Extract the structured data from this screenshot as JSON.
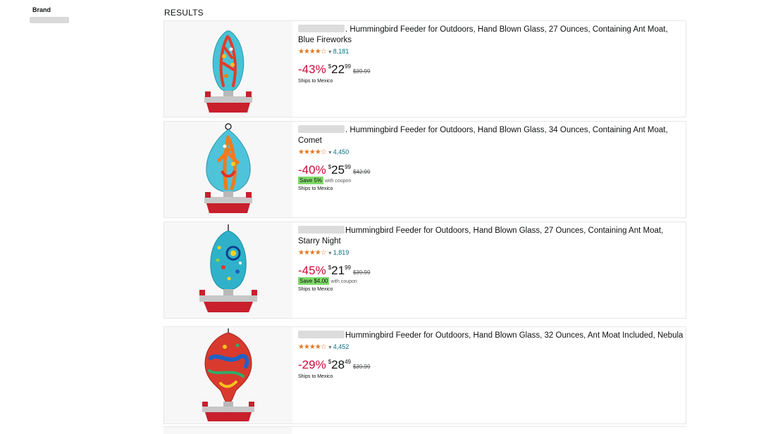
{
  "sidebar": {
    "brand_heading": "Brand"
  },
  "results": {
    "heading": "RESULTS",
    "items": [
      {
        "title": ". Hummingbird Feeder for Outdoors, Hand Blown Glass, 27 Ounces, Containing Ant Moat, Blue Fireworks",
        "stars": "★★★★☆",
        "rating_count": "8,181",
        "discount": "-43%",
        "currency": "$",
        "price_whole": "22",
        "price_fraction": "99",
        "list_price": "$39.99",
        "coupon_badge": "",
        "coupon_text": "",
        "shipping": "Ships to Mexico"
      },
      {
        "title": ". Hummingbird Feeder for Outdoors, Hand Blown Glass, 34 Ounces, Containing Ant Moat, Comet",
        "stars": "★★★★☆",
        "rating_count": "4,450",
        "discount": "-40%",
        "currency": "$",
        "price_whole": "25",
        "price_fraction": "99",
        "list_price": "$42.99",
        "coupon_badge": "Save 5%",
        "coupon_text": "with coupon",
        "shipping": "Ships to Mexico"
      },
      {
        "title": "Hummingbird Feeder for Outdoors, Hand Blown Glass, 27 Ounces, Containing Ant Moat, Starry Night",
        "stars": "★★★★☆",
        "rating_count": "1,819",
        "discount": "-45%",
        "currency": "$",
        "price_whole": "21",
        "price_fraction": "99",
        "list_price": "$39.99",
        "coupon_badge": "Save $4.00",
        "coupon_text": "with coupon",
        "shipping": "Ships to Mexico"
      },
      {
        "title": "Hummingbird Feeder for Outdoors, Hand Blown Glass, 32 Ounces, Ant Moat Included, Nebula",
        "stars": "★★★★☆",
        "rating_count": "4,452",
        "discount": "-29%",
        "currency": "$",
        "price_whole": "28",
        "price_fraction": "49",
        "list_price": "$39.99",
        "coupon_badge": "",
        "coupon_text": "",
        "shipping": "Ships to Mexico"
      }
    ]
  },
  "colors": {
    "rating_link": "#007185",
    "star": "#de7921",
    "discount": "#cc0c39",
    "coupon_badge": "#7fda69",
    "feeder_base": "#c8202c"
  }
}
